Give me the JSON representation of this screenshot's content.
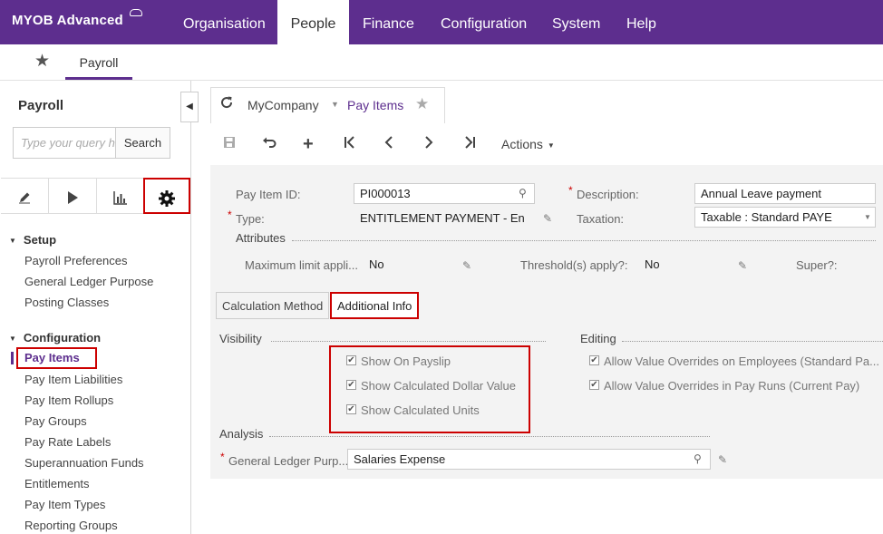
{
  "topbar": {
    "logo": "MYOB Advanced",
    "nav": [
      "Organisation",
      "People",
      "Finance",
      "Configuration",
      "System",
      "Help"
    ]
  },
  "subbar": {
    "tab": "Payroll"
  },
  "sidebar": {
    "title": "Payroll",
    "search_placeholder": "Type your query h",
    "search_button": "Search",
    "groups": [
      {
        "label": "Setup",
        "items": [
          "Payroll Preferences",
          "General Ledger Purpose",
          "Posting Classes"
        ]
      },
      {
        "label": "Configuration",
        "items": [
          "Pay Items",
          "Pay Item Liabilities",
          "Pay Item Rollups",
          "Pay Groups",
          "Pay Rate Labels",
          "Superannuation Funds",
          "Entitlements",
          "Pay Item Types",
          "Reporting Groups"
        ]
      }
    ],
    "icons": [
      "pencil-icon",
      "play-icon",
      "chart-icon",
      "gear-icon"
    ]
  },
  "breadcrumb": {
    "company": "MyCompany",
    "page": "Pay Items"
  },
  "toolbar": {
    "actions_label": "Actions"
  },
  "form": {
    "pay_item_id_label": "Pay Item ID:",
    "pay_item_id": "PI000013",
    "description_label": "Description:",
    "description": "Annual Leave payment",
    "type_label": "Type:",
    "type": "ENTITLEMENT PAYMENT - En",
    "taxation_label": "Taxation:",
    "taxation": "Taxable : Standard PAYE",
    "attributes_label": "Attributes",
    "max_limit_label": "Maximum limit appli...",
    "max_limit": "No",
    "threshold_label": "Threshold(s) apply?:",
    "threshold": "No",
    "super_label": "Super?:"
  },
  "tabs": [
    "Calculation Method",
    "Additional Info"
  ],
  "additional": {
    "visibility_label": "Visibility",
    "visibility": [
      "Show On Payslip",
      "Show Calculated Dollar Value",
      "Show Calculated Units"
    ],
    "editing_label": "Editing",
    "editing": [
      "Allow Value Overrides on Employees (Standard Pa...",
      "Allow Value Overrides in Pay Runs (Current Pay)"
    ],
    "analysis_label": "Analysis",
    "gl_label": "General Ledger Purp...",
    "gl_value": "Salaries Expense"
  }
}
